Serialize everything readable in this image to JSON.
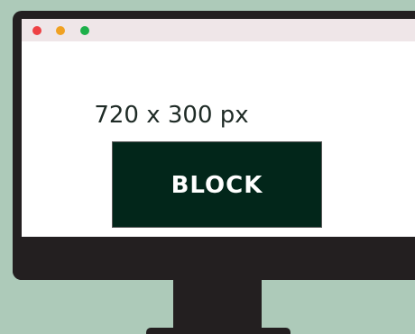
{
  "window": {
    "controls": [
      {
        "name": "close",
        "color": "#ee4144"
      },
      {
        "name": "minimize",
        "color": "#f0a122"
      },
      {
        "name": "maximize",
        "color": "#1db04a"
      }
    ]
  },
  "content": {
    "size_label": "720 x 300 px",
    "block_label": "BLOCK",
    "block_color": "#02261a"
  },
  "colors": {
    "background": "#adcab9",
    "monitor": "#231f20",
    "titlebar": "#efe6e8"
  }
}
